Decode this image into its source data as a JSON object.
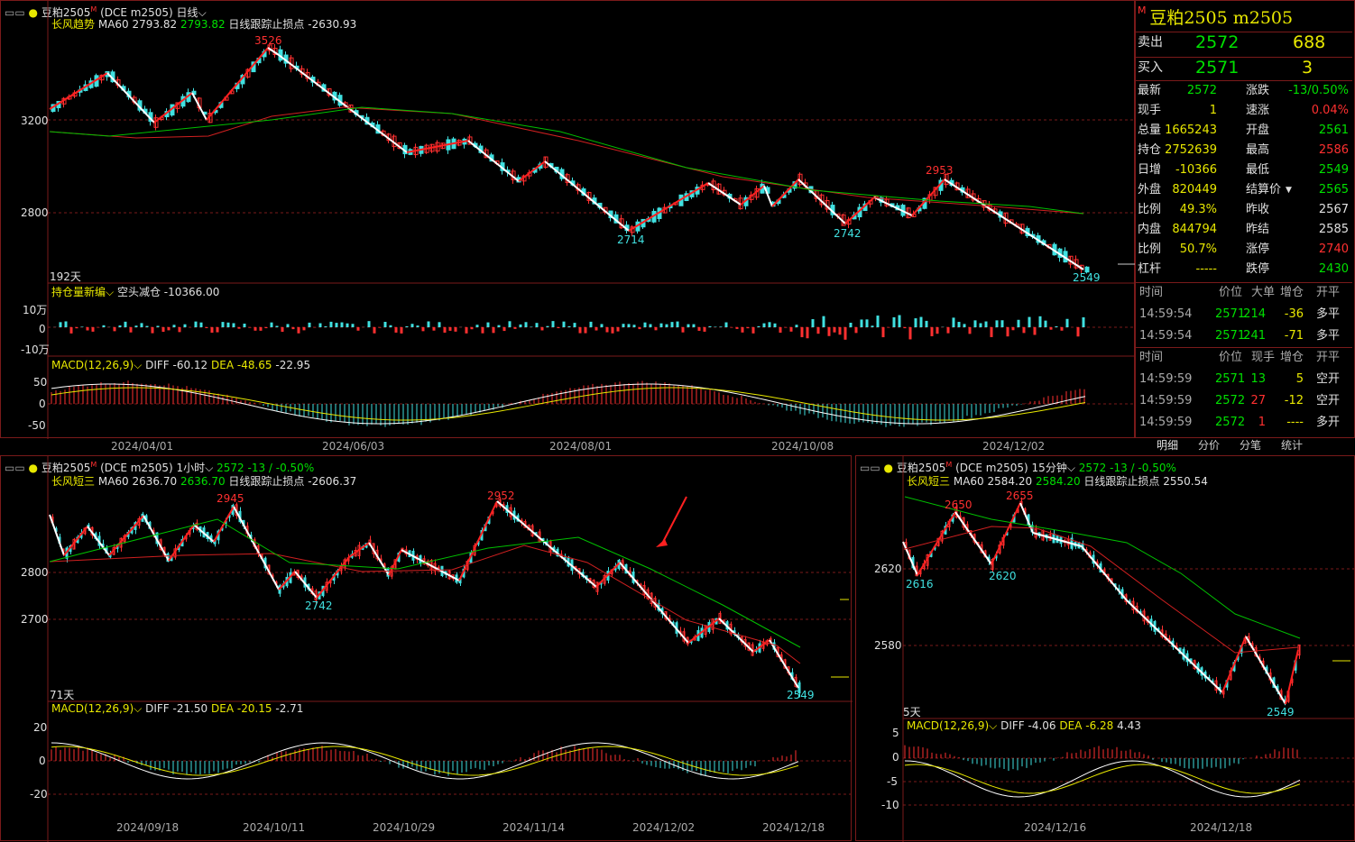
{
  "top_panel": {
    "header": {
      "symbol": "豆粕2505",
      "sup": "M",
      "code": "(DCE m2505)",
      "period": "日线"
    },
    "legend": {
      "indicator": "长风趋势",
      "ma_label": "MA60",
      "ma_val": "2793.82",
      "ma_val2": "2793.82",
      "stop_label": "日线跟踪止损点",
      "stop_val": "-2630.93"
    },
    "y_ticks": [
      "3200",
      "2800"
    ],
    "x_ticks": [
      "2024/04/01",
      "2024/06/03",
      "2024/08/01",
      "2024/10/08",
      "2024/12/02"
    ],
    "days": "192天",
    "peaks": [
      {
        "v": "3526",
        "c": "#ff3030"
      },
      {
        "v": "2714",
        "c": "#40e0e0"
      },
      {
        "v": "2742",
        "c": "#40e0e0"
      },
      {
        "v": "2953",
        "c": "#ff3030"
      },
      {
        "v": "2549",
        "c": "#40e0e0"
      }
    ],
    "oi_legend": {
      "name": "持仓量新编",
      "label": "空头减仓",
      "val": "-10366.00"
    },
    "oi_ticks": [
      "10万",
      "0",
      "-10万"
    ],
    "macd_legend": {
      "name": "MACD(12,26,9)",
      "diff_label": "DIFF",
      "diff": "-60.12",
      "dea_label": "DEA",
      "dea": "-48.65",
      "macd": "-22.95"
    },
    "macd_ticks": [
      "50",
      "0",
      "-50"
    ]
  },
  "quote": {
    "flag": "M",
    "title": "豆粕2505  m2505",
    "sell": {
      "label": "卖出",
      "price": "2572",
      "vol": "688"
    },
    "buy": {
      "label": "买入",
      "price": "2571",
      "vol": "3"
    },
    "rows": [
      {
        "l1": "最新",
        "v1": "2572",
        "c1": "#00e000",
        "l2": "涨跌",
        "v2": "-13/0.50%",
        "c2": "#00e000"
      },
      {
        "l1": "现手",
        "v1": "1",
        "c1": "#e8e800",
        "l2": "速涨",
        "v2": "0.04%",
        "c2": "#ff3030"
      },
      {
        "l1": "总量",
        "v1": "1665243",
        "c1": "#e8e800",
        "l2": "开盘",
        "v2": "2561",
        "c2": "#00e000"
      },
      {
        "l1": "持仓",
        "v1": "2752639",
        "c1": "#e8e800",
        "l2": "最高",
        "v2": "2586",
        "c2": "#ff3030"
      },
      {
        "l1": "日增",
        "v1": "-10366",
        "c1": "#e8e800",
        "l2": "最低",
        "v2": "2549",
        "c2": "#00e000"
      },
      {
        "l1": "外盘",
        "v1": "820449",
        "c1": "#e8e800",
        "l2": "结算价",
        "v2": "2565",
        "c2": "#00e000"
      },
      {
        "l1": "比例",
        "v1": "49.3%",
        "c1": "#e8e800",
        "l2": "昨收",
        "v2": "2567",
        "c2": "#e0e0e0"
      },
      {
        "l1": "内盘",
        "v1": "844794",
        "c1": "#e8e800",
        "l2": "昨结",
        "v2": "2585",
        "c2": "#e0e0e0"
      },
      {
        "l1": "比例",
        "v1": "50.7%",
        "c1": "#e8e800",
        "l2": "涨停",
        "v2": "2740",
        "c2": "#ff3030"
      },
      {
        "l1": "杠杆",
        "v1": "-----",
        "c1": "#e8e800",
        "l2": "跌停",
        "v2": "2430",
        "c2": "#00e000"
      }
    ],
    "detail_headers": [
      "时间",
      "价位",
      "大单",
      "增仓",
      "开平"
    ],
    "detail_rows": [
      {
        "t": "14:59:54",
        "p": "2571",
        "a": "214",
        "b": "-36",
        "k": "多平"
      },
      {
        "t": "14:59:54",
        "p": "2571",
        "a": "241",
        "b": "-71",
        "k": "多平"
      }
    ],
    "tick_headers": [
      "时间",
      "价位",
      "现手",
      "增仓",
      "开平"
    ],
    "tick_rows": [
      {
        "t": "14:59:59",
        "p": "2571",
        "a": "13",
        "ac": "#00e000",
        "b": "5",
        "k": "空开"
      },
      {
        "t": "14:59:59",
        "p": "2572",
        "a": "27",
        "ac": "#ff3030",
        "b": "-12",
        "k": "空开"
      },
      {
        "t": "14:59:59",
        "p": "2572",
        "a": "1",
        "ac": "#ff3030",
        "b": "----",
        "k": "多开"
      }
    ],
    "tabs": [
      "明细",
      "分价",
      "分笔",
      "统计"
    ]
  },
  "left_panel": {
    "header": {
      "symbol": "豆粕2505",
      "sup": "M",
      "code": "(DCE m2505)",
      "period": "1小时",
      "price": "2572",
      "chg": "-13 / -0.50%"
    },
    "legend": {
      "indicator": "长风短三",
      "ma_label": "MA60",
      "ma_val": "2636.70",
      "ma_val2": "2636.70",
      "stop_label": "日线跟踪止损点",
      "stop_val": "-2606.37"
    },
    "y_ticks": [
      "2800",
      "2700"
    ],
    "x_ticks": [
      "2024/09/18",
      "2024/10/11",
      "2024/10/29",
      "2024/11/14",
      "2024/12/02",
      "2024/12/18"
    ],
    "days": "71天",
    "peaks": [
      {
        "v": "2945",
        "c": "#ff3030"
      },
      {
        "v": "2742",
        "c": "#40e0e0"
      },
      {
        "v": "2952",
        "c": "#ff3030"
      },
      {
        "v": "2549",
        "c": "#40e0e0"
      }
    ],
    "macd_legend": {
      "name": "MACD(12,26,9)",
      "diff_label": "DIFF",
      "diff": "-21.50",
      "dea_label": "DEA",
      "dea": "-20.15",
      "macd": "-2.71"
    },
    "macd_ticks": [
      "20",
      "0",
      "-20"
    ]
  },
  "right_panel": {
    "header": {
      "symbol": "豆粕2505",
      "sup": "M",
      "code": "(DCE m2505)",
      "period": "15分钟",
      "price": "2572",
      "chg": "-13 / -0.50%"
    },
    "legend": {
      "indicator": "长风短三",
      "ma_label": "MA60",
      "ma_val": "2584.20",
      "ma_val2": "2584.20",
      "stop_label": "日线跟踪止损点",
      "stop_val": "2550.54"
    },
    "y_ticks": [
      "2620",
      "2580"
    ],
    "x_ticks": [
      "2024/12/16",
      "2024/12/18"
    ],
    "days": "5天",
    "peaks": [
      {
        "v": "2650",
        "c": "#ff3030"
      },
      {
        "v": "2655",
        "c": "#ff3030"
      },
      {
        "v": "2616",
        "c": "#40e0e0"
      },
      {
        "v": "2620",
        "c": "#40e0e0"
      },
      {
        "v": "2549",
        "c": "#40e0e0"
      }
    ],
    "macd_legend": {
      "name": "MACD(12,26,9)",
      "diff_label": "DIFF",
      "diff": "-4.06",
      "dea_label": "DEA",
      "dea": "-6.28",
      "macd": "4.43"
    },
    "macd_ticks": [
      "5",
      "0",
      "-5",
      "-10"
    ]
  },
  "colors": {
    "up": "#ff3030",
    "down": "#40e0e0",
    "ma": "#00c000",
    "grid": "#7a1a1a",
    "text_accent": "#e8e800"
  }
}
